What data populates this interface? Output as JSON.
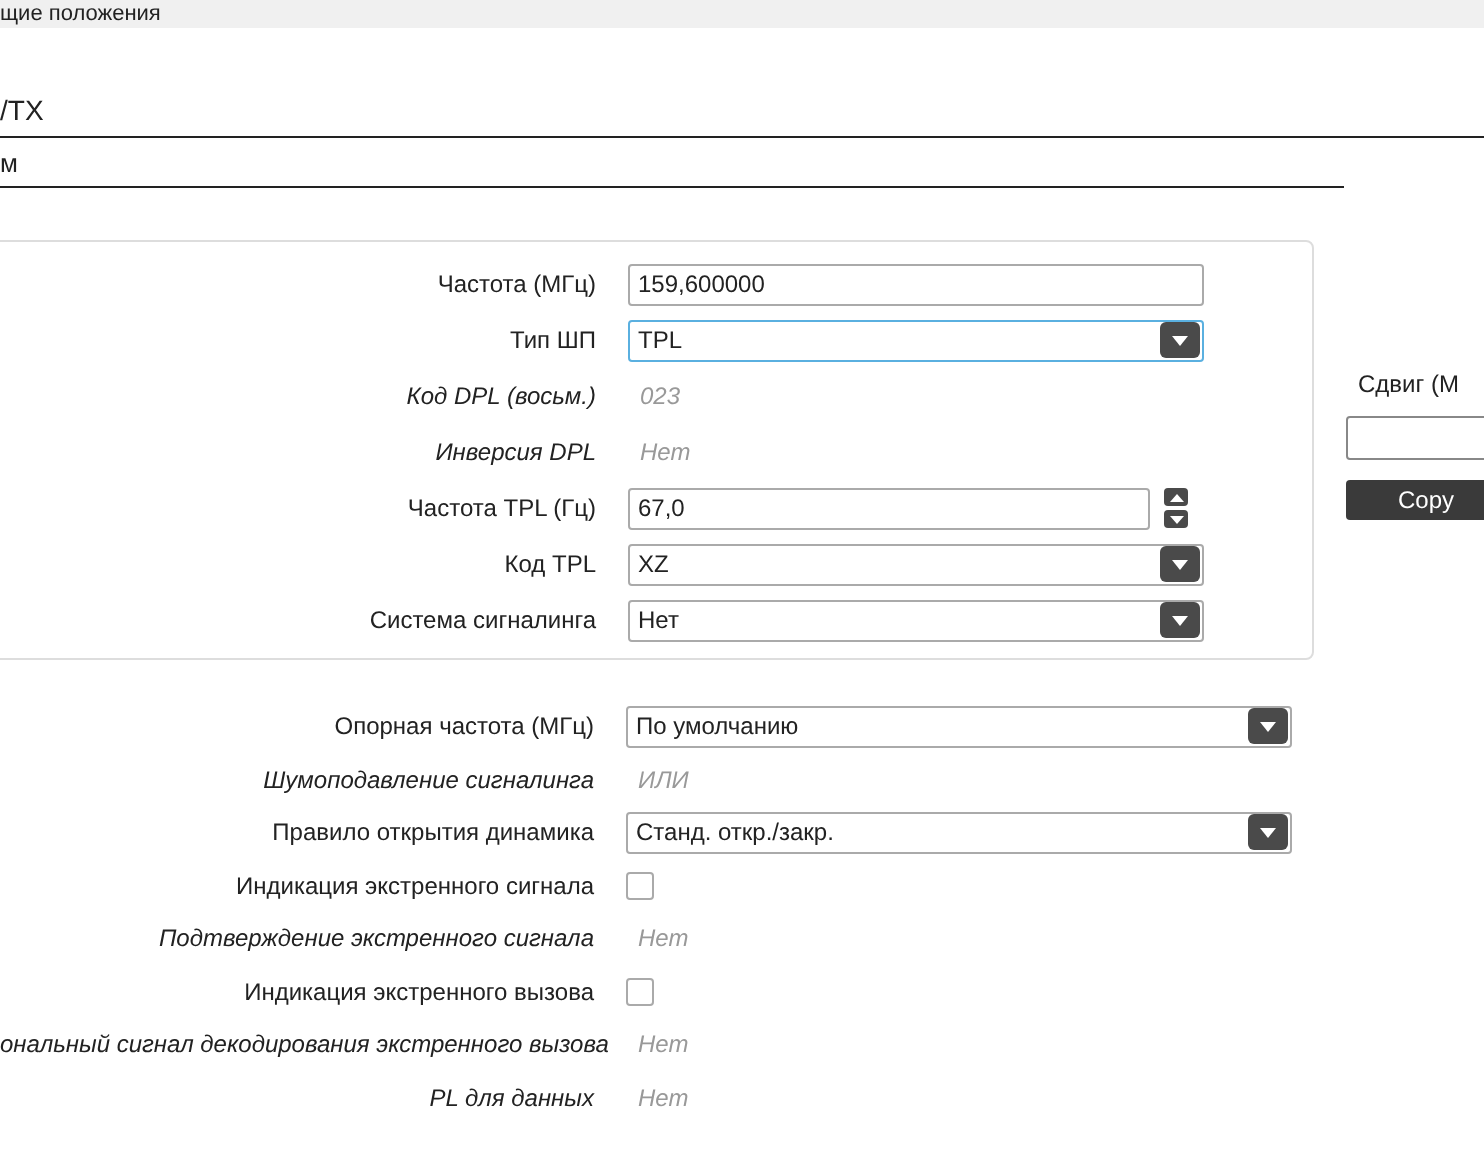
{
  "header": {
    "title": "щие положения"
  },
  "section_title": "/TX",
  "subsection_title": "м",
  "group": {
    "rows": [
      {
        "kind": "text",
        "label": "Частота (МГц)",
        "value": "159,600000",
        "focused": false
      },
      {
        "kind": "select",
        "label": "Тип ШП",
        "value": "TPL",
        "focused": true
      },
      {
        "kind": "readonly",
        "label": "Код DPL (восьм.)",
        "value": "023"
      },
      {
        "kind": "readonly",
        "label": "Инверсия DPL",
        "value": "Нет"
      },
      {
        "kind": "spin",
        "label": "Частота TPL (Гц)",
        "value": "67,0",
        "focused": false
      },
      {
        "kind": "select",
        "label": "Код TPL",
        "value": "XZ",
        "focused": false
      },
      {
        "kind": "select",
        "label": "Система сигналинга",
        "value": "Нет",
        "focused": false
      }
    ]
  },
  "shift": {
    "label": "Сдвиг (М",
    "button": "Copy"
  },
  "rows": [
    {
      "kind": "select",
      "label": "Опорная частота (МГц)",
      "value": "По умолчанию",
      "focused": false
    },
    {
      "kind": "readonly",
      "label": "Шумоподавление сигналинга",
      "value": "ИЛИ"
    },
    {
      "kind": "select",
      "label": "Правило открытия динамика",
      "value": "Станд. откр./закр.",
      "focused": false
    },
    {
      "kind": "checkbox",
      "label": "Индикация экстренного сигнала",
      "checked": false
    },
    {
      "kind": "readonly",
      "label": "Подтверждение экстренного сигнала",
      "value": "Нет"
    },
    {
      "kind": "checkbox",
      "label": "Индикация экстренного вызова",
      "checked": false
    },
    {
      "kind": "readonly",
      "label": "ональный сигнал декодирования экстренного вызова",
      "value": "Нет"
    },
    {
      "kind": "readonly",
      "label": "PL для данных",
      "value": "Нет"
    }
  ]
}
